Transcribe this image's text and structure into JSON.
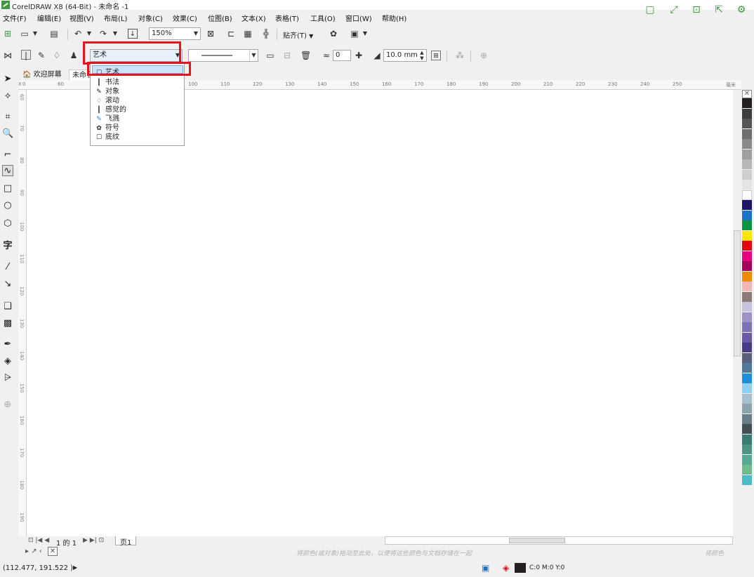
{
  "window": {
    "title": "CorelDRAW X8 (64-Bit) - 未命名 -1"
  },
  "top_right_icons": [
    "restore-icon",
    "fullscreen-icon",
    "save-icon",
    "share-icon",
    "settings-icon"
  ],
  "menu": {
    "items": [
      "文件(F)",
      "编辑(E)",
      "视图(V)",
      "布局(L)",
      "对象(C)",
      "效果(C)",
      "位图(B)",
      "文本(X)",
      "表格(T)",
      "工具(O)",
      "窗口(W)",
      "帮助(H)"
    ]
  },
  "standard_toolbar": {
    "zoom_value": "150%",
    "snap_label": "贴齐(T)"
  },
  "property_bar": {
    "preset_value": "艺术",
    "smoothing_value": "0",
    "width_value": "10.0 mm"
  },
  "preset_dropdown": {
    "items": [
      {
        "label": "艺术",
        "icon": "art-brush-icon",
        "selected": true
      },
      {
        "label": "书法",
        "icon": "calligraphy-icon",
        "selected": false
      },
      {
        "label": "对象",
        "icon": "object-sprayer-icon",
        "selected": false
      },
      {
        "label": "滚动",
        "icon": "scroll-icon",
        "selected": false
      },
      {
        "label": "感觉的",
        "icon": "pressure-icon",
        "selected": false
      },
      {
        "label": "飞溅",
        "icon": "splatter-icon",
        "selected": false
      },
      {
        "label": "符号",
        "icon": "symbol-icon",
        "selected": false
      },
      {
        "label": "底纹",
        "icon": "texture-icon",
        "selected": false
      }
    ]
  },
  "tabs": {
    "welcome": "欢迎屏幕",
    "document": "未命名"
  },
  "ruler": {
    "corner": "X",
    "units_label": "毫米",
    "h_ticks": [
      "0",
      "60",
      "100",
      "110",
      "120",
      "130",
      "140",
      "150",
      "160",
      "170",
      "180",
      "190",
      "200",
      "210",
      "220",
      "230",
      "240",
      "250"
    ],
    "v_ticks": [
      "60",
      "70",
      "80",
      "90",
      "100",
      "110",
      "120",
      "130",
      "140",
      "150",
      "160",
      "170",
      "180",
      "190"
    ]
  },
  "page_nav": {
    "counter": "1 的 1",
    "page_tab": "页1"
  },
  "document_palette": {
    "hint": "将颜色(或对象)拖动至此处，以便将这些颜色与文档存储在一起",
    "label": "将颜色"
  },
  "status": {
    "coordinates": "(112.477, 191.522 )",
    "fill_info": "C:0 M:0 Y:0"
  },
  "palette_colors": [
    "#231f20",
    "#3d3d3d",
    "#555555",
    "#6d6d6d",
    "#888888",
    "#9f9f9f",
    "#b7b7b7",
    "#cfcfcf",
    "#e4e4e4",
    "#ffffff",
    "#1b1464",
    "#1a73c7",
    "#0a9444",
    "#ffe600",
    "#e30613",
    "#e6007e",
    "#a4005b",
    "#f08a00",
    "#f3b6b6",
    "#8c7b75",
    "#c9c2de",
    "#9f92c8",
    "#7c72b6",
    "#6a5aa6",
    "#463c85",
    "#58607a",
    "#4d7a9c",
    "#1c8fd6",
    "#8dd0f2",
    "#a6c0cc",
    "#8ba4ad",
    "#6a7e89",
    "#414f57",
    "#3b7a74",
    "#4a9488",
    "#56a894",
    "#6fba8f",
    "#4fbac8"
  ],
  "colors": {
    "accent_green": "#3c9a3c",
    "highlight_red": "#e8141d",
    "selection_blue": "#cce4f7"
  }
}
